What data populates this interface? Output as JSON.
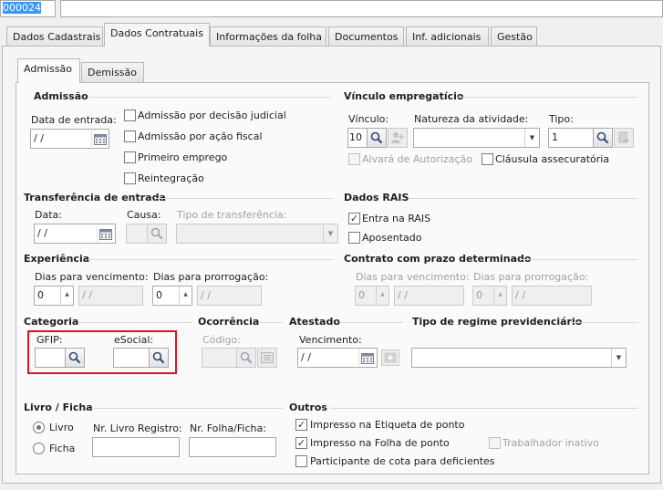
{
  "top": {
    "code_value": "000024"
  },
  "main_tabs": [
    {
      "label": "Dados Cadastrais"
    },
    {
      "label": "Dados Contratuais"
    },
    {
      "label": "Informações da folha"
    },
    {
      "label": "Documentos"
    },
    {
      "label": "Inf. adicionais"
    },
    {
      "label": "Gestão"
    }
  ],
  "sub_tabs": [
    {
      "label": "Admissão"
    },
    {
      "label": "Demissão"
    }
  ],
  "admissao": {
    "title": "Admissão",
    "data_entrada_label": "Data de entrada:",
    "data_entrada_value": " / /",
    "checks": [
      {
        "label": "Admissão por decisão judicial"
      },
      {
        "label": "Admissão por ação fiscal"
      },
      {
        "label": "Primeiro emprego"
      },
      {
        "label": "Reintegração"
      }
    ]
  },
  "vinculo": {
    "title": "Vínculo empregatício",
    "vinculo_label": "Vínculo:",
    "vinculo_value": "10",
    "natureza_label": "Natureza da atividade:",
    "natureza_value": "",
    "tipo_label": "Tipo:",
    "tipo_value": "1",
    "alvara_label": "Alvará de Autorização",
    "clausula_label": "Cláusula assecuratória"
  },
  "transferencia": {
    "title": "Transferência de entrada",
    "data_label": "Data:",
    "data_value": " / /",
    "causa_label": "Causa:",
    "tipo_label": "Tipo de transferência:"
  },
  "rais": {
    "title": "Dados RAIS",
    "entra_label": "Entra na RAIS",
    "aposentado_label": "Aposentado"
  },
  "experiencia": {
    "title": "Experiência",
    "dias_venc_label": "Dias para vencimento:",
    "dias_venc_value": "0",
    "dias_venc_date": " / /",
    "dias_prorr_label": "Dias para prorrogação:",
    "dias_prorr_value": "0",
    "dias_prorr_date": " / /"
  },
  "prazo": {
    "title": "Contrato com prazo determinado",
    "dias_venc_label": "Dias para vencimento:",
    "dias_venc_value": "0",
    "dias_venc_date": " / /",
    "dias_prorr_label": "Dias para prorrogação:",
    "dias_prorr_value": "0",
    "dias_prorr_date": " / /"
  },
  "categoria": {
    "title": "Categoria",
    "gfip_label": "GFIP:",
    "esocial_label": "eSocial:",
    "highlight_color": "#e0141e"
  },
  "ocorrencia": {
    "title": "Ocorrência",
    "codigo_label": "Código:"
  },
  "atestado": {
    "title": "Atestado",
    "vencimento_label": "Vencimento:",
    "vencimento_value": " / /"
  },
  "regime": {
    "title": "Tipo de regime previdenciário"
  },
  "livro": {
    "title": "Livro / Ficha",
    "livro_label": "Livro",
    "ficha_label": "Ficha",
    "nr_livro_label": "Nr. Livro Registro:",
    "nr_folha_label": "Nr. Folha/Ficha:"
  },
  "outros": {
    "title": "Outros",
    "etiqueta_label": "Impresso na Etiqueta de ponto",
    "folha_label": "Impresso na Folha de ponto",
    "inativo_label": "Trabalhador inativo",
    "cota_label": "Participante de cota para deficientes"
  }
}
